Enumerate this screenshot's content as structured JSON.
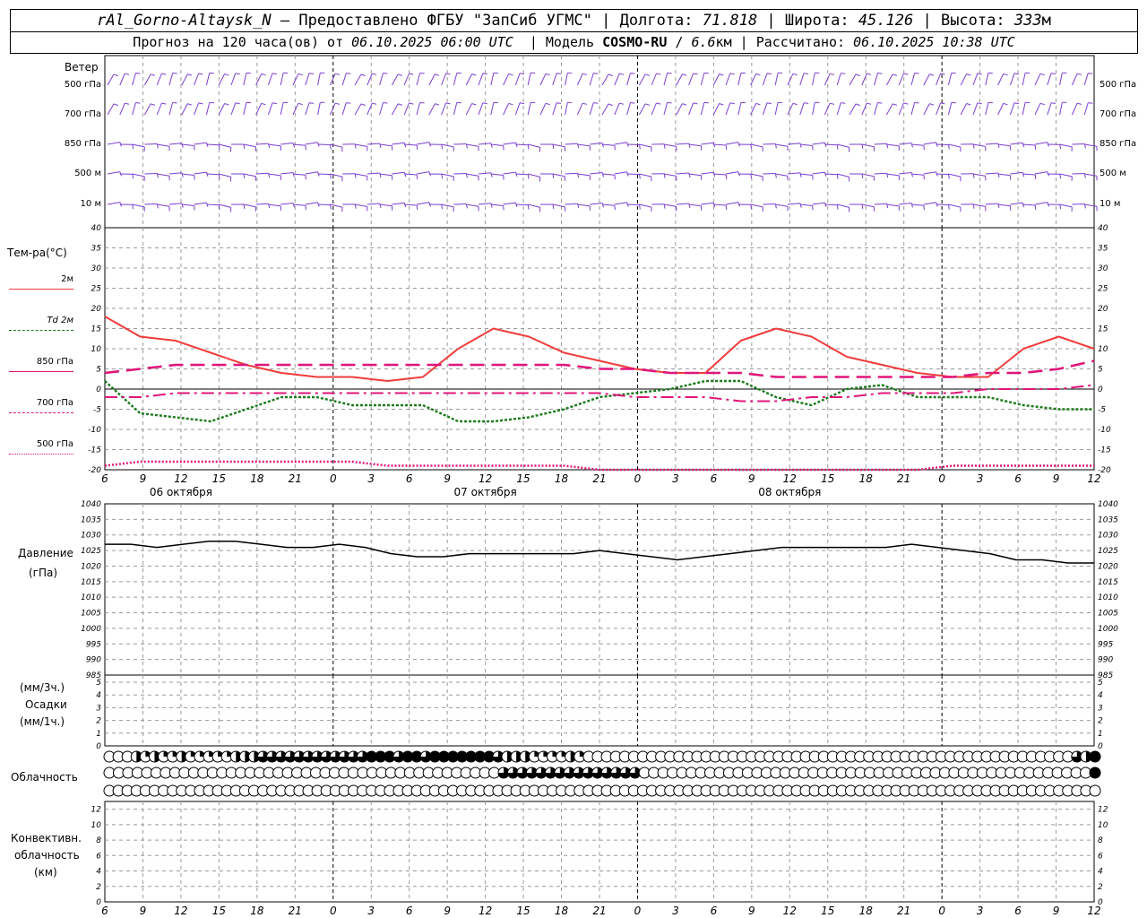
{
  "header": {
    "station": "rAl_Gorno-Altaysk_N",
    "dash": "–",
    "provider": "Предоставлено ФГБУ \"ЗапСиб УГМС\"",
    "lon_label": "Долгота:",
    "lon_value": "71.818",
    "lat_label": "Широта:",
    "lat_value": "45.126",
    "alt_label": "Высота:",
    "alt_value": "333",
    "alt_unit": "м",
    "forecast_label": "Прогноз на 120 часа(ов)  от",
    "forecast_start": "06.10.2025 06:00 UTC",
    "model_label": "Модель",
    "model_name": "COSMO-RU",
    "model_res": "6.6",
    "model_res_unit": "км",
    "calc_label": "Рассчитано:",
    "calc_time": "06.10.2025 10:38 UTC"
  },
  "colors": {
    "t2m": "#f03c3c",
    "td2m": "#1b7a1b",
    "levels": "#e0157a",
    "wind": "#7a3fd0",
    "grid": "#9a9a9a"
  },
  "wind": {
    "title": "Ветер",
    "levels": [
      "500 гПа",
      "700 гПа",
      "850 гПа",
      "500  м",
      "10  м"
    ],
    "levels_right": [
      "500 гПа",
      "700 гПа",
      "850 гПа",
      "500 м",
      "10 м"
    ]
  },
  "temperature": {
    "title": "Тем-ра(°С)",
    "legend": [
      {
        "label": "2м",
        "style": "solid"
      },
      {
        "label": "Td  2м",
        "style": "dotted"
      },
      {
        "label": "850 гПа",
        "style": "dashed"
      },
      {
        "label": "700 гПа",
        "style": "dashdot"
      },
      {
        "label": "500 гПа",
        "style": "dotted-fine"
      }
    ]
  },
  "pressure": {
    "title": "Давление",
    "unit": "(гПа)"
  },
  "precip": {
    "unit_top": "(мм/3ч.)",
    "title": "Осадки",
    "unit_bottom": "(мм/1ч.)"
  },
  "clouds": {
    "title": "Облачность"
  },
  "convective": {
    "title1": "Конвективн.",
    "title2": "облачность",
    "unit": "(км)"
  },
  "dates": [
    "06 октября",
    "07 октября",
    "08 октября"
  ],
  "chart_data": [
    {
      "type": "line",
      "panel": "temperature",
      "x_hours": [
        0,
        3,
        6,
        9,
        12,
        15,
        18,
        21,
        24,
        27,
        30,
        33,
        36,
        39,
        42,
        45,
        48,
        51,
        54,
        57,
        60,
        63,
        66,
        69,
        72,
        75,
        78
      ],
      "x_ticks": [
        "6",
        "9",
        "12",
        "15",
        "18",
        "21",
        "0",
        "3",
        "6",
        "9",
        "12",
        "15",
        "18",
        "21",
        "0",
        "3",
        "6",
        "9",
        "12",
        "15",
        "18",
        "21",
        "0",
        "3",
        "6",
        "9",
        "12"
      ],
      "ylim": [
        -20,
        40
      ],
      "yticks": [
        -20,
        -15,
        -10,
        -5,
        0,
        5,
        10,
        15,
        20,
        25,
        30,
        35,
        40
      ],
      "series": [
        {
          "name": "2м",
          "values": [
            18,
            13,
            12,
            9,
            6,
            4,
            3,
            3,
            2,
            3,
            10,
            15,
            13,
            9,
            7,
            5,
            4,
            4,
            12,
            15,
            13,
            8,
            6,
            4,
            3,
            3,
            10,
            13,
            10
          ]
        },
        {
          "name": "Td  2м",
          "values": [
            2,
            -6,
            -7,
            -8,
            -5,
            -2,
            -2,
            -4,
            -4,
            -4,
            -8,
            -8,
            -7,
            -5,
            -2,
            -1,
            0,
            2,
            2,
            -2,
            -4,
            0,
            1,
            -2,
            -2,
            -2,
            -4,
            -5,
            -5
          ]
        },
        {
          "name": "850 гПа",
          "values": [
            4,
            5,
            6,
            6,
            6,
            6,
            6,
            6,
            6,
            6,
            6,
            6,
            6,
            6,
            5,
            5,
            4,
            4,
            4,
            3,
            3,
            3,
            3,
            3,
            3,
            4,
            4,
            5,
            7
          ]
        },
        {
          "name": "700 гПа",
          "values": [
            -2,
            -2,
            -1,
            -1,
            -1,
            -1,
            -1,
            -1,
            -1,
            -1,
            -1,
            -1,
            -1,
            -1,
            -1,
            -2,
            -2,
            -2,
            -3,
            -3,
            -2,
            -2,
            -1,
            -1,
            -1,
            0,
            0,
            0,
            1
          ]
        },
        {
          "name": "500 гПа",
          "values": [
            -19,
            -18,
            -18,
            -18,
            -18,
            -18,
            -18,
            -18,
            -19,
            -19,
            -19,
            -19,
            -19,
            -19,
            -20,
            -20,
            -20,
            -20,
            -20,
            -20,
            -20,
            -20,
            -20,
            -20,
            -19,
            -19,
            -19,
            -19,
            -19
          ]
        }
      ]
    },
    {
      "type": "line",
      "panel": "pressure",
      "ylim": [
        985,
        1040
      ],
      "yticks": [
        985,
        990,
        995,
        1000,
        1005,
        1010,
        1015,
        1020,
        1025,
        1030,
        1035,
        1040
      ],
      "series": [
        {
          "name": "Давление",
          "values": [
            1027,
            1027,
            1026,
            1027,
            1028,
            1028,
            1027,
            1026,
            1026,
            1027,
            1026,
            1024,
            1023,
            1023,
            1024,
            1024,
            1024,
            1024,
            1024,
            1025,
            1024,
            1023,
            1022,
            1023,
            1024,
            1025,
            1026,
            1026,
            1026,
            1026,
            1026,
            1027,
            1026,
            1025,
            1024,
            1022,
            1022,
            1021,
            1021
          ]
        }
      ]
    },
    {
      "type": "bar",
      "panel": "precipitation",
      "ylim": [
        0,
        5
      ],
      "yticks": [
        0,
        1,
        2,
        3,
        4,
        5
      ],
      "values": []
    },
    {
      "type": "bar",
      "panel": "convective",
      "ylim": [
        0,
        13
      ],
      "yticks": [
        0,
        2,
        4,
        6,
        8,
        10,
        12
      ],
      "values": []
    }
  ],
  "cloud_rows": [
    [
      0,
      0,
      0,
      2,
      1,
      2,
      1,
      1,
      2,
      1,
      1,
      1,
      1,
      1,
      2,
      2,
      2,
      3,
      3,
      3,
      3,
      3,
      3,
      3,
      3,
      3,
      3,
      3,
      3,
      4,
      4,
      4,
      3,
      4,
      4,
      3,
      4,
      4,
      4,
      4,
      4,
      4,
      4,
      3,
      2,
      2,
      2,
      1,
      1,
      1,
      1,
      2,
      1,
      0,
      0,
      0,
      0,
      0,
      0,
      0,
      0,
      0,
      0,
      0,
      0,
      0,
      0,
      0,
      0,
      0,
      0,
      0,
      0,
      0,
      0,
      0,
      0,
      0,
      0,
      0,
      0,
      0,
      0,
      0,
      0,
      0,
      0,
      0,
      0,
      0,
      0,
      0,
      0,
      0,
      0,
      0,
      0,
      0,
      0,
      0,
      0,
      0,
      0,
      0,
      0,
      0,
      0,
      3,
      2,
      4
    ],
    [
      0,
      0,
      0,
      0,
      0,
      0,
      0,
      0,
      0,
      0,
      0,
      0,
      0,
      0,
      0,
      0,
      0,
      0,
      0,
      0,
      0,
      0,
      0,
      0,
      0,
      0,
      0,
      0,
      0,
      0,
      0,
      0,
      0,
      0,
      0,
      0,
      0,
      0,
      0,
      0,
      0,
      0,
      3,
      3,
      3,
      3,
      3,
      3,
      3,
      3,
      3,
      3,
      3,
      3,
      3,
      3,
      3,
      0,
      0,
      0,
      0,
      0,
      0,
      0,
      0,
      0,
      0,
      0,
      0,
      0,
      0,
      0,
      0,
      0,
      0,
      0,
      0,
      0,
      0,
      0,
      0,
      0,
      0,
      0,
      0,
      0,
      0,
      0,
      0,
      0,
      0,
      0,
      0,
      0,
      0,
      0,
      0,
      0,
      0,
      0,
      0,
      0,
      0,
      0,
      0,
      4
    ],
    [
      0,
      0,
      0,
      0,
      0,
      0,
      0,
      0,
      0,
      0,
      0,
      0,
      0,
      0,
      0,
      0,
      0,
      0,
      0,
      0,
      0,
      0,
      0,
      0,
      0,
      0,
      0,
      0,
      0,
      0,
      0,
      0,
      0,
      0,
      0,
      0,
      0,
      0,
      0,
      0,
      0,
      0,
      0,
      0,
      0,
      0,
      0,
      0,
      0,
      0,
      0,
      0,
      0,
      0,
      0,
      0,
      0,
      0,
      0,
      0,
      0,
      0,
      0,
      0,
      0,
      0,
      0,
      0,
      0,
      0,
      0,
      0,
      0,
      0,
      0,
      0,
      0,
      0,
      0,
      0,
      0,
      0,
      0,
      0,
      0,
      0,
      0,
      0,
      0,
      0,
      0,
      0,
      0,
      0,
      0,
      0,
      0,
      0,
      0,
      0,
      0,
      0,
      0,
      0,
      0,
      0,
      0,
      0,
      0,
      0
    ]
  ]
}
